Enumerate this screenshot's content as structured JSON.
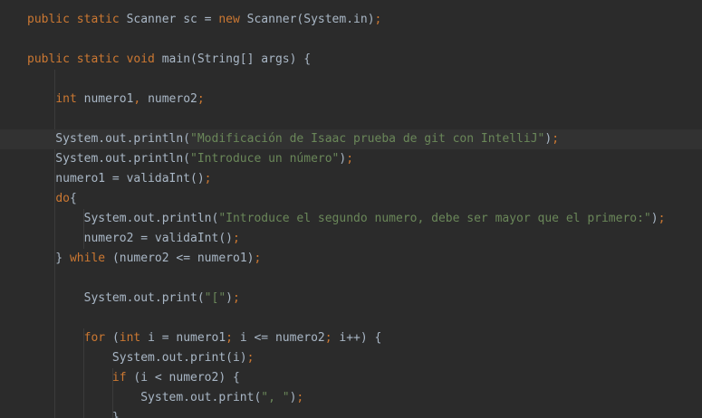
{
  "editor": {
    "lines": [
      [
        {
          "t": "public static ",
          "c": "kw"
        },
        {
          "t": "Scanner sc = ",
          "c": "plain"
        },
        {
          "t": "new ",
          "c": "kw"
        },
        {
          "t": "Scanner(System.in)",
          "c": "plain"
        },
        {
          "t": ";",
          "c": "kw"
        }
      ],
      [],
      [
        {
          "t": "public static void ",
          "c": "kw"
        },
        {
          "t": "main(String[] args) {",
          "c": "plain"
        }
      ],
      [],
      [
        {
          "t": "    ",
          "c": "plain"
        },
        {
          "t": "int ",
          "c": "kw"
        },
        {
          "t": "numero1",
          "c": "plain"
        },
        {
          "t": ", ",
          "c": "kw"
        },
        {
          "t": "numero2",
          "c": "plain"
        },
        {
          "t": ";",
          "c": "kw"
        }
      ],
      [],
      [
        {
          "t": "    System.out.println(",
          "c": "plain"
        },
        {
          "t": "\"Modificación de Isaac prueba de git con IntelliJ\"",
          "c": "str"
        },
        {
          "t": ")",
          "c": "plain"
        },
        {
          "t": ";",
          "c": "kw"
        }
      ],
      [
        {
          "t": "    System.out.println(",
          "c": "plain"
        },
        {
          "t": "\"Introduce un número\"",
          "c": "str"
        },
        {
          "t": ")",
          "c": "plain"
        },
        {
          "t": ";",
          "c": "kw"
        }
      ],
      [
        {
          "t": "    numero1 = validaInt()",
          "c": "plain"
        },
        {
          "t": ";",
          "c": "kw"
        }
      ],
      [
        {
          "t": "    ",
          "c": "plain"
        },
        {
          "t": "do",
          "c": "kw"
        },
        {
          "t": "{",
          "c": "plain"
        }
      ],
      [
        {
          "t": "        System.out.println(",
          "c": "plain"
        },
        {
          "t": "\"Introduce el segundo numero, debe ser mayor que el primero:\"",
          "c": "str"
        },
        {
          "t": ")",
          "c": "plain"
        },
        {
          "t": ";",
          "c": "kw"
        }
      ],
      [
        {
          "t": "        numero2 = validaInt()",
          "c": "plain"
        },
        {
          "t": ";",
          "c": "kw"
        }
      ],
      [
        {
          "t": "    } ",
          "c": "plain"
        },
        {
          "t": "while ",
          "c": "kw"
        },
        {
          "t": "(numero2 <= numero1)",
          "c": "plain"
        },
        {
          "t": ";",
          "c": "kw"
        }
      ],
      [],
      [
        {
          "t": "        System.out.print(",
          "c": "plain"
        },
        {
          "t": "\"[\"",
          "c": "str"
        },
        {
          "t": ")",
          "c": "plain"
        },
        {
          "t": ";",
          "c": "kw"
        }
      ],
      [],
      [
        {
          "t": "        ",
          "c": "plain"
        },
        {
          "t": "for ",
          "c": "kw"
        },
        {
          "t": "(",
          "c": "plain"
        },
        {
          "t": "int ",
          "c": "kw"
        },
        {
          "t": "i = numero1",
          "c": "plain"
        },
        {
          "t": "; ",
          "c": "kw"
        },
        {
          "t": "i <= numero2",
          "c": "plain"
        },
        {
          "t": "; ",
          "c": "kw"
        },
        {
          "t": "i++) {",
          "c": "plain"
        }
      ],
      [
        {
          "t": "            System.out.print(i)",
          "c": "plain"
        },
        {
          "t": ";",
          "c": "kw"
        }
      ],
      [
        {
          "t": "            ",
          "c": "plain"
        },
        {
          "t": "if ",
          "c": "kw"
        },
        {
          "t": "(i < numero2) {",
          "c": "plain"
        }
      ],
      [
        {
          "t": "                System.out.print(",
          "c": "plain"
        },
        {
          "t": "\", \"",
          "c": "str"
        },
        {
          "t": ")",
          "c": "plain"
        },
        {
          "t": ";",
          "c": "kw"
        }
      ],
      [
        {
          "t": "            }",
          "c": "plain"
        }
      ]
    ],
    "current_line_index": 6,
    "gutter_icon": "lightbulb-icon"
  },
  "colors": {
    "background": "#2b2b2b",
    "current_line": "#323232",
    "keyword": "#cc7832",
    "string": "#6a8759",
    "plain": "#a9b7c6"
  }
}
